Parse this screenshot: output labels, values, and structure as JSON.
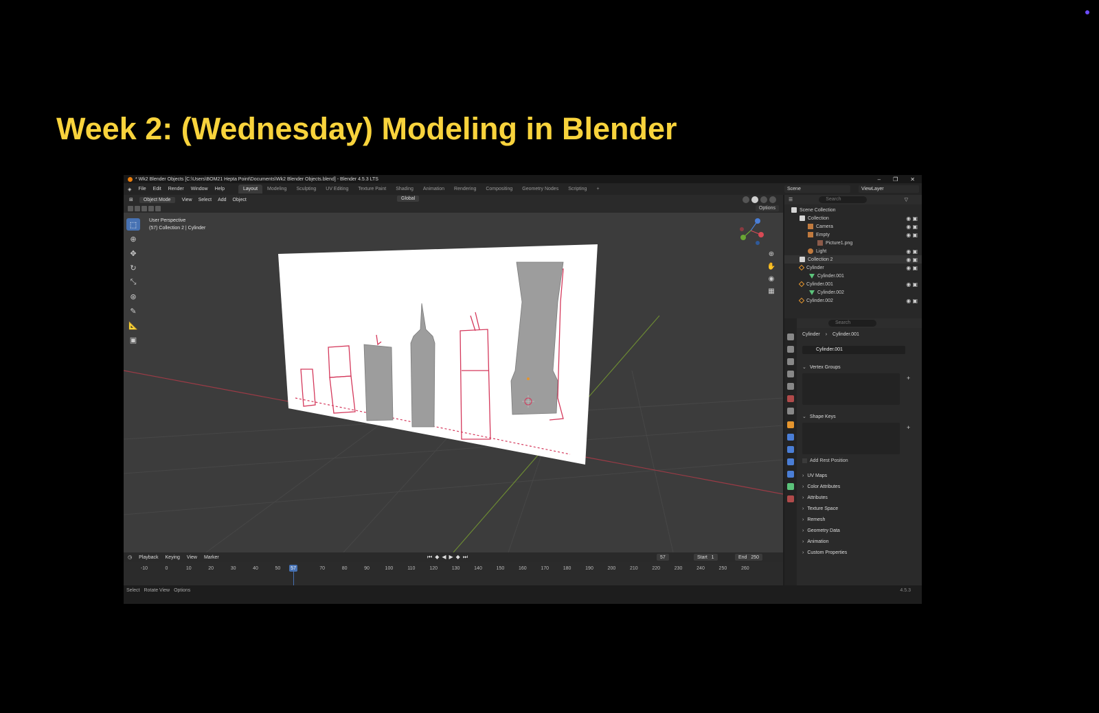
{
  "slide": {
    "title": "Week 2: (Wednesday) Modeling in Blender"
  },
  "window": {
    "title": "* Wk2 Blender Objects [C:\\Users\\BOM21 Hepta Point\\Documents\\Wk2 Blender Objects.blend] - Blender 4.5.3 LTS",
    "controls": [
      "–",
      "❐",
      "✕"
    ]
  },
  "menus": [
    "File",
    "Edit",
    "Render",
    "Window",
    "Help"
  ],
  "workspaces": [
    "Layout",
    "Modeling",
    "Sculpting",
    "UV Editing",
    "Texture Paint",
    "Shading",
    "Animation",
    "Rendering",
    "Compositing",
    "Geometry Nodes",
    "Scripting",
    "+"
  ],
  "active_workspace": "Layout",
  "scene": "Scene",
  "view_layer": "ViewLayer",
  "viewport": {
    "mode": "Object Mode",
    "menus": [
      "View",
      "Select",
      "Add",
      "Object"
    ],
    "orientation": "Global",
    "options": "Options",
    "info_line1": "User Perspective",
    "info_line2": "(57) Collection 2 | Cylinder"
  },
  "timeline": {
    "menus": [
      "Playback",
      "Keying",
      "View",
      "Marker"
    ],
    "current_frame": "57",
    "start_label": "Start",
    "start": "1",
    "end_label": "End",
    "end": "250",
    "ticks": [
      "-10",
      "0",
      "10",
      "20",
      "30",
      "40",
      "50",
      "60",
      "70",
      "80",
      "90",
      "100",
      "110",
      "120",
      "130",
      "140",
      "150",
      "160",
      "170",
      "180",
      "190",
      "200",
      "210",
      "220",
      "230",
      "240",
      "250",
      "260"
    ],
    "playhead_label": "57"
  },
  "status": {
    "items": [
      "Select",
      "Rotate View",
      "Options"
    ],
    "version": "4.5.3"
  },
  "outliner": {
    "search_placeholder": "Search",
    "rows": [
      {
        "label": "Scene Collection",
        "icon": "scene-collection-icon"
      },
      {
        "label": "Collection",
        "icon": "collection-icon"
      },
      {
        "label": "Camera",
        "icon": "camera-icon"
      },
      {
        "label": "Empty",
        "icon": "empty-icon"
      },
      {
        "label": "Picture1.png",
        "icon": "image-icon"
      },
      {
        "label": "Light",
        "icon": "light-icon"
      },
      {
        "label": "Collection 2",
        "icon": "collection-icon"
      },
      {
        "label": "Cylinder",
        "icon": "mesh-object-icon"
      },
      {
        "label": "Cylinder.001",
        "icon": "mesh-data-icon"
      },
      {
        "label": "Cylinder.001",
        "icon": "mesh-object-icon"
      },
      {
        "label": "Cylinder.002",
        "icon": "mesh-data-icon"
      },
      {
        "label": "Cylinder.002",
        "icon": "mesh-object-icon"
      }
    ]
  },
  "properties": {
    "search_placeholder": "Search",
    "breadcrumb_object": "Cylinder",
    "breadcrumb_data": "Cylinder.001",
    "mesh_name": "Cylinder.001",
    "panels": {
      "vertex_groups": "Vertex Groups",
      "shape_keys": "Shape Keys",
      "add_rest_position": "Add Rest Position",
      "collapsed": [
        "UV Maps",
        "Color Attributes",
        "Attributes",
        "Texture Space",
        "Remesh",
        "Geometry Data",
        "Animation",
        "Custom Properties"
      ]
    }
  },
  "colors": {
    "title_yellow": "#f8d33c",
    "accent_blue": "#4772b3",
    "outline_red": "#d4375a",
    "object_orange": "#e5952e"
  }
}
